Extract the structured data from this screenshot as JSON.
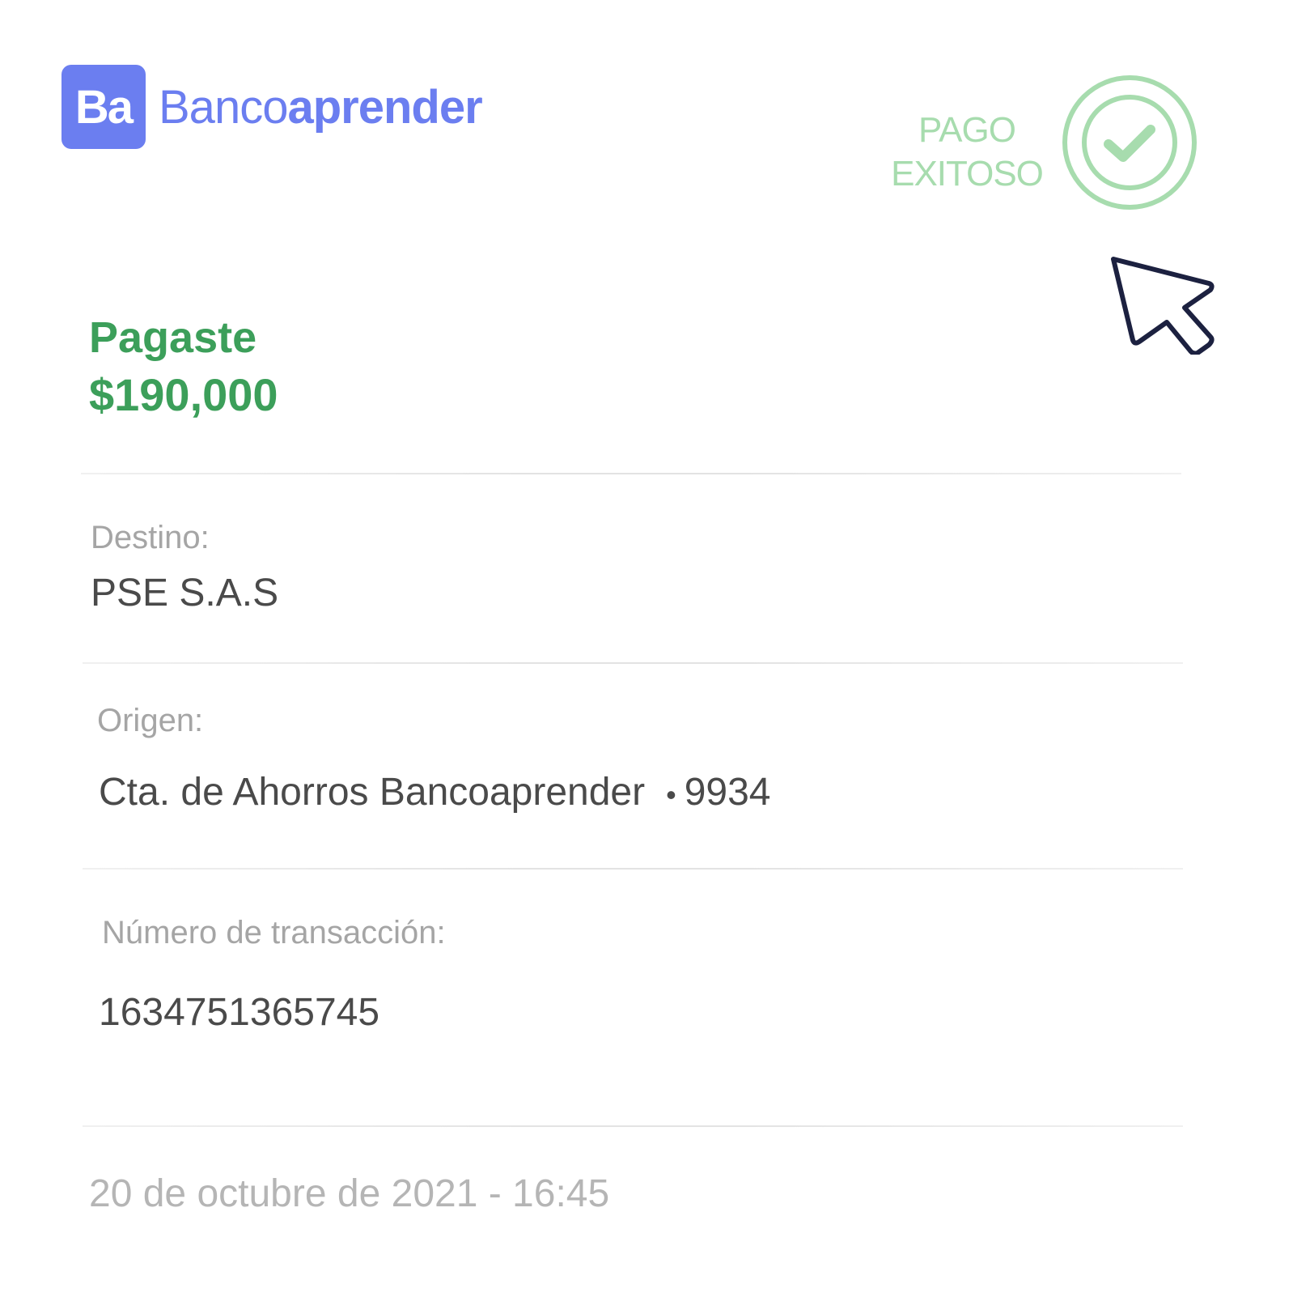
{
  "brand": {
    "logo_text": "Ba",
    "name_light": "Banco",
    "name_bold": "aprender",
    "color": "#6b7ef0"
  },
  "status": {
    "line1": "PAGO",
    "line2": "EXITOSO",
    "icon": "check-circle-icon",
    "color": "#a7dcae"
  },
  "cursor": {
    "icon": "mouse-pointer-icon"
  },
  "payment": {
    "label": "Pagaste",
    "amount": "$190,000",
    "color": "#3c9f5a"
  },
  "destination": {
    "label": "Destino:",
    "value": "PSE S.A.S"
  },
  "origin": {
    "label": "Origen:",
    "account": "Cta. de Ahorros Bancoaprender",
    "separator": "•",
    "last_digits": "9934"
  },
  "transaction": {
    "label": "Número de transacción:",
    "value": "1634751365745"
  },
  "datetime": "20 de octubre de 2021 - 16:45"
}
